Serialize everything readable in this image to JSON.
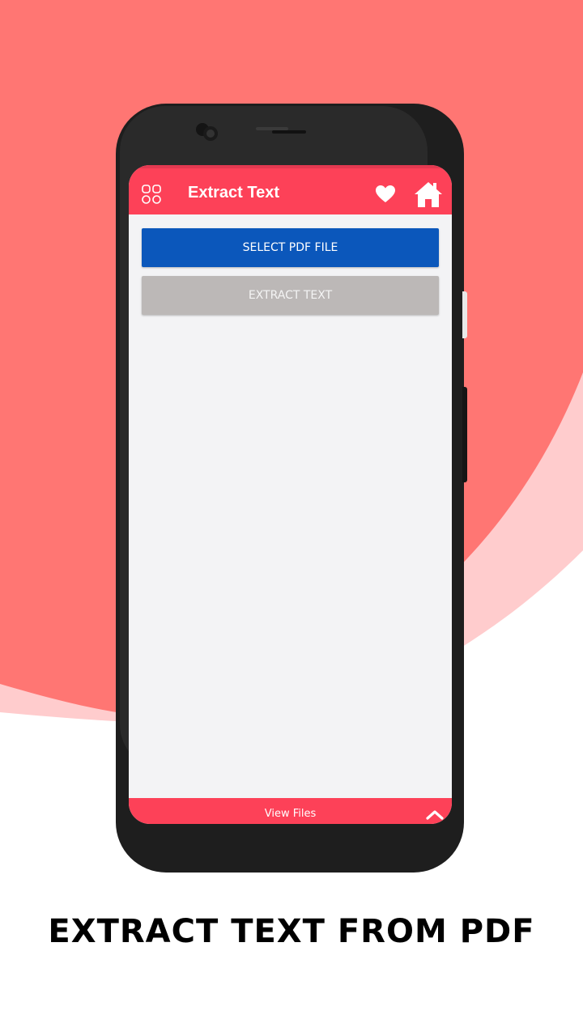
{
  "colors": {
    "background_red": "#ff7673",
    "background_pink": "#ffcccd",
    "app_bar": "#fd4158",
    "select_button": "#0b57bb",
    "extract_button": "#bcb8b7",
    "screen_bg": "#f3f3f5"
  },
  "app_bar": {
    "menu_icon": "grid-menu-icon",
    "title": "Extract Text",
    "favorite_icon": "heart-icon",
    "home_icon": "home-icon"
  },
  "buttons": {
    "select_label": "SELECT PDF FILE",
    "extract_label": "EXTRACT TEXT"
  },
  "bottom_bar": {
    "label": "View Files",
    "icon": "chevron-up-icon"
  },
  "caption": "EXTRACT TEXT FROM PDF"
}
